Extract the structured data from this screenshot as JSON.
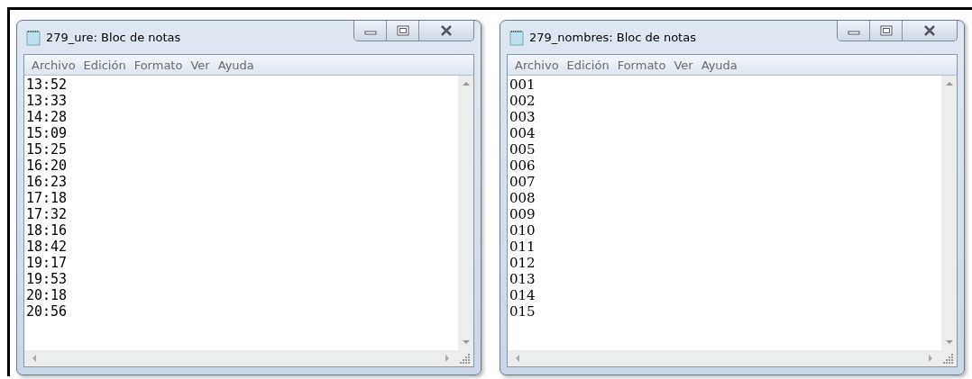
{
  "windows": [
    {
      "title": "279_ure: Bloc de notas",
      "menu": [
        "Archivo",
        "Edición",
        "Formato",
        "Ver",
        "Ayuda"
      ],
      "kind": "mono",
      "lines": [
        "13:52",
        "13:33",
        "14:28",
        "15:09",
        "15:25",
        "16:20",
        "16:23",
        "17:18",
        "17:32",
        "18:16",
        "18:42",
        "19:17",
        "19:53",
        "20:18",
        "20:56"
      ]
    },
    {
      "title": "279_nombres: Bloc de notas",
      "menu": [
        "Archivo",
        "Edición",
        "Formato",
        "Ver",
        "Ayuda"
      ],
      "kind": "serif",
      "lines": [
        "001",
        "002",
        "003",
        "004",
        "005",
        "006",
        "007",
        "008",
        "009",
        "010",
        "011",
        "012",
        "013",
        "014",
        "015"
      ]
    }
  ]
}
